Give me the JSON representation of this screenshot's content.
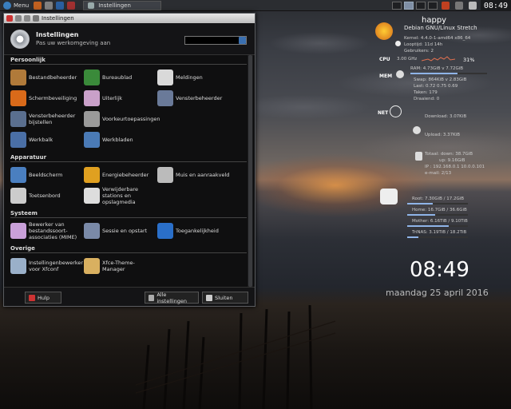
{
  "panel": {
    "menu_label": "Menu",
    "task_label": "Instellingen",
    "clock": "08:49"
  },
  "window": {
    "title": "Instellingen",
    "header_title": "Instellingen",
    "header_subtitle": "Pas uw werkomgeving aan",
    "search_placeholder": "",
    "sections": [
      {
        "title": "Persoonlijk",
        "items": [
          {
            "label": "Bestandbeheerder",
            "icon": "file-manager-icon",
            "color": "#b07a3a"
          },
          {
            "label": "Bureaublad",
            "icon": "desktop-icon",
            "color": "#3a8a3a"
          },
          {
            "label": "Meldingen",
            "icon": "notifications-icon",
            "color": "#d9d9d9"
          },
          {
            "label": "Schermbeveiliging",
            "icon": "screensaver-icon",
            "color": "#d96a1a"
          },
          {
            "label": "Uiterlijk",
            "icon": "appearance-icon",
            "color": "#c9a0c9"
          },
          {
            "label": "Vensterbeheerder",
            "icon": "window-manager-icon",
            "color": "#6a7a99"
          },
          {
            "label": "Vensterbeheerder bijstellen",
            "icon": "window-manager-tweaks-icon",
            "color": "#5a6f8f"
          },
          {
            "label": "Voorkeurtoepassingen",
            "icon": "preferred-apps-icon",
            "color": "#9a9a9a"
          },
          {
            "label": "",
            "icon": "",
            "color": ""
          },
          {
            "label": "Werkbalk",
            "icon": "panel-icon",
            "color": "#4a6fa6"
          },
          {
            "label": "Werkbladen",
            "icon": "workspaces-icon",
            "color": "#4a7ab6"
          },
          {
            "label": "",
            "icon": "",
            "color": ""
          }
        ]
      },
      {
        "title": "Apparatuur",
        "items": [
          {
            "label": "Beeldscherm",
            "icon": "display-icon",
            "color": "#4a7fc0"
          },
          {
            "label": "Energiebeheerder",
            "icon": "power-manager-icon",
            "color": "#e0a020"
          },
          {
            "label": "Muis en aanraakveld",
            "icon": "mouse-icon",
            "color": "#bbbbbb"
          },
          {
            "label": "Toetsenbord",
            "icon": "keyboard-icon",
            "color": "#cccccc"
          },
          {
            "label": "Verwijderbare stations en opslagmedia",
            "icon": "removable-drive-icon",
            "color": "#dddddd"
          },
          {
            "label": "",
            "icon": "",
            "color": ""
          }
        ]
      },
      {
        "title": "Systeem",
        "items": [
          {
            "label": "Bewerker van bestandssoort-associaties (MIME)",
            "icon": "mime-editor-icon",
            "color": "#c9a0d9"
          },
          {
            "label": "Sessie en opstart",
            "icon": "session-icon",
            "color": "#7a8aa8"
          },
          {
            "label": "Toegankelijkheid",
            "icon": "accessibility-icon",
            "color": "#2a6fc9"
          }
        ]
      },
      {
        "title": "Overige",
        "items": [
          {
            "label": "Instellingenbewerker voor Xfconf",
            "icon": "settings-editor-icon",
            "color": "#9ab0c9"
          },
          {
            "label": "Xfce-Theme-Manager",
            "icon": "theme-manager-icon",
            "color": "#d9b060"
          },
          {
            "label": "",
            "icon": "",
            "color": ""
          }
        ]
      }
    ],
    "footer": {
      "help_label": "Hulp",
      "all_settings_label": "Alle instellingen",
      "close_label": "Sluiten"
    }
  },
  "conky": {
    "hostname": "happy",
    "distro": "Debian GNU/Linux Stretch",
    "kernel": "Kernel: 4.4.0-1-amd64 x86_64",
    "uptime": "Looptijd: 11d 14h",
    "users": "Gebruikers: 2",
    "cpu_label": "CPU",
    "cpu_freq": "3.00 GHz",
    "cpu_percent": "31%",
    "cpu_fraction": 0.31,
    "mem_label": "MEM",
    "ram": "RAM: 4.73GiB v 7.72GiB",
    "ram_fraction": 0.61,
    "swap": "Swap: 864KiB v 2.83GiB",
    "load": "Last: 0.72 0.75 0.69",
    "tasks": "Taken: 179",
    "running": "Draaiend: 0",
    "net_label": "NET",
    "download": "Download: 3.07KiB",
    "upload": "Upload: 3.37KiB",
    "total_down": "Totaal: down: 38.7GiB",
    "total_up": "up: 9.16GiB",
    "ip": "IP      : 192.168.0.1  10.0.0.101",
    "email": "e-mail: 2/13",
    "disks": [
      {
        "label": "Root: 7.30GiB / 17.2GiB",
        "fraction": 0.42
      },
      {
        "label": "Home: 16.7GiB / 36.6GiB",
        "fraction": 0.46
      },
      {
        "label": "Mother: 6.16TiB / 9.10TiB",
        "fraction": 0.68
      },
      {
        "label": "TriNAS: 3.19TiB / 18.2TiB",
        "fraction": 0.18
      }
    ],
    "big_clock": "08:49",
    "date": "maandag 25 april 2016"
  }
}
